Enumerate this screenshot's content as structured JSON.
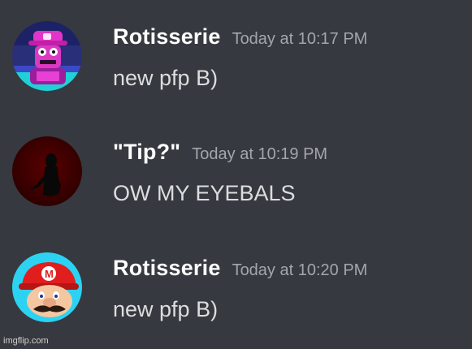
{
  "messages": [
    {
      "username": "Rotisserie",
      "timestamp": "Today at 10:17 PM",
      "text": "new pfp B)",
      "avatar": "waluigi-style-avatar"
    },
    {
      "username": "\"Tip?\"",
      "timestamp": "Today at 10:19 PM",
      "text": "OW MY EYEBALS",
      "avatar": "dark-shadow-figure-avatar"
    },
    {
      "username": "Rotisserie",
      "timestamp": "Today at 10:20 PM",
      "text": "new pfp B)",
      "avatar": "mario-style-avatar"
    }
  ],
  "watermark": "imgflip.com",
  "colors": {
    "background": "#36393f",
    "username": "#ffffff",
    "timestamp": "#a3a6aa",
    "message_text": "#dcddde"
  }
}
